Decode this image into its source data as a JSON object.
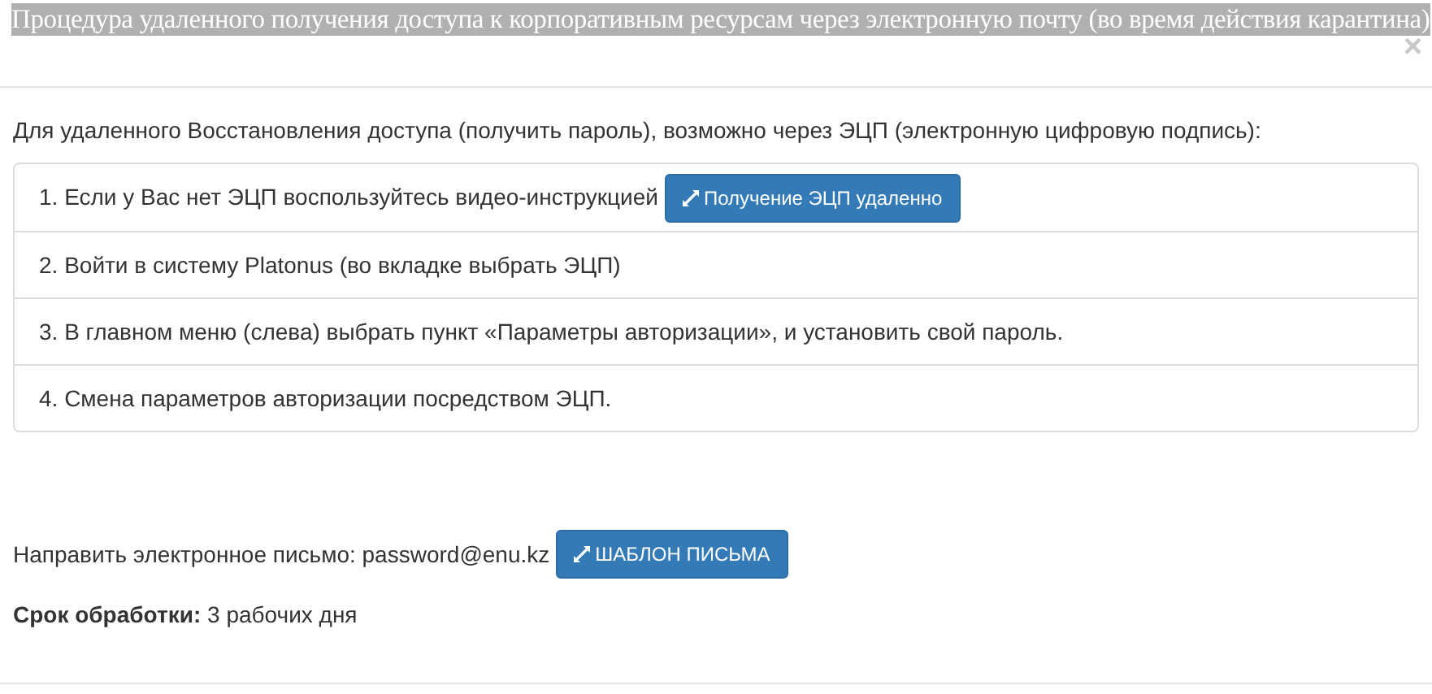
{
  "modal": {
    "title": "Процедура удаленного получения доступа к корпоративным ресурсам через электронную почту (во время действия карантина)",
    "close": "×"
  },
  "intro": "Для удаленного Восстановления доступа (получить пароль), возможно через ЭЦП (электронную цифровую подпись):",
  "steps": [
    {
      "kind": "with_button",
      "text": "1. Если у Вас нет ЭЦП воспользуйтесь видео-инструкцией",
      "button": "Получение ЭЦП удаленно"
    },
    {
      "kind": "text",
      "text": "2. Войти в систему Platonus (во вкладке выбрать ЭЦП)"
    },
    {
      "kind": "text",
      "text": "3. В главном меню (слева) выбрать пункт «Параметры авторизации», и установить свой пароль."
    },
    {
      "kind": "text",
      "text": "4. Смена параметров авторизации посредством ЭЦП."
    }
  ],
  "email": {
    "text": "Направить электронное письмо: password@enu.kz",
    "button": "ШАБЛОН ПИСЬМА"
  },
  "deadline": "**Срок обработки:** 3 рабочих дня"
}
